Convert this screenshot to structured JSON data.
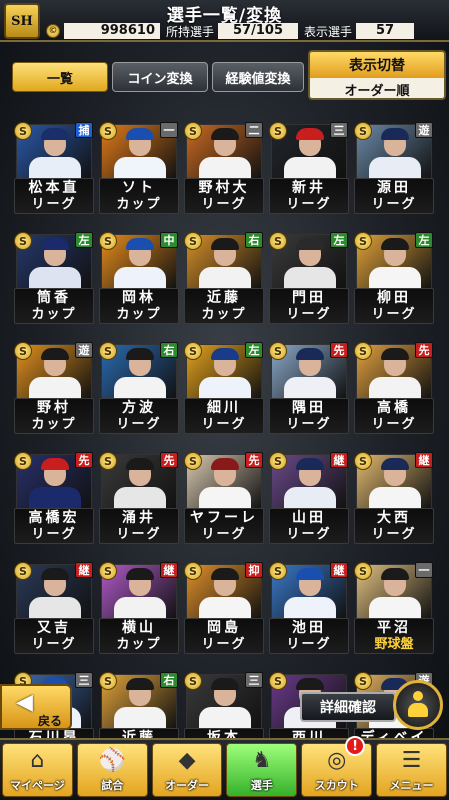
{
  "header": {
    "logo": "SH",
    "title": "選手一覧/変換",
    "coins": "998610",
    "owned_label": "所持選手",
    "owned_value": "57/105",
    "displayed_label": "表示選手",
    "displayed_value": "57"
  },
  "tabs": [
    "一覧",
    "コイン変換",
    "経験値変換"
  ],
  "display_switch": {
    "label": "表示切替",
    "value": "オーダー順"
  },
  "colors": {
    "gold": "#ffd23a",
    "green": "#36b12a",
    "alert": "#e21a1a"
  },
  "players": [
    {
      "name": "松本直",
      "type": "リーグ",
      "pos": "捕",
      "pos_color": "#1e5fd6",
      "bg": "#2a58a8",
      "cap": "#1a2f6a",
      "body": "#e8eef8"
    },
    {
      "name": "ソト",
      "type": "カップ",
      "pos": "一",
      "pos_color": "#6a6a6a",
      "bg": "#e07a1a",
      "cap": "#1a4fb0",
      "body": "#f0f4fb"
    },
    {
      "name": "野村大",
      "type": "リーグ",
      "pos": "二",
      "pos_color": "#6a6a6a",
      "bg": "#c96a22",
      "cap": "#1a1a1a",
      "body": "#f3f3f3"
    },
    {
      "name": "新井",
      "type": "リーグ",
      "pos": "三",
      "pos_color": "#6a6a6a",
      "bg": "#20242a",
      "cap": "#c81e1e",
      "body": "#f2f2f2"
    },
    {
      "name": "源田",
      "type": "リーグ",
      "pos": "遊",
      "pos_color": "#6a6a6a",
      "bg": "#6a8aa8",
      "cap": "#1a2a58",
      "body": "#e8ecf4"
    },
    {
      "name": "筒香",
      "type": "カップ",
      "pos": "左",
      "pos_color": "#2e8a2e",
      "bg": "#24386a",
      "cap": "#1a2a6a",
      "body": "#dde3f0"
    },
    {
      "name": "岡林",
      "type": "カップ",
      "pos": "中",
      "pos_color": "#2e8a2e",
      "bg": "#e38a1c",
      "cap": "#1a4fb0",
      "body": "#eef2fa"
    },
    {
      "name": "近藤",
      "type": "カップ",
      "pos": "右",
      "pos_color": "#2e8a2e",
      "bg": "#d6902a",
      "cap": "#1a1a1a",
      "body": "#f2f2f2"
    },
    {
      "name": "門田",
      "type": "リーグ",
      "pos": "左",
      "pos_color": "#2e8a2e",
      "bg": "#3a3a3a",
      "cap": "#2a2a2a",
      "body": "#e6e6e6"
    },
    {
      "name": "柳田",
      "type": "リーグ",
      "pos": "左",
      "pos_color": "#2e8a2e",
      "bg": "#e0a23a",
      "cap": "#1a1a1a",
      "body": "#f5f5f5"
    },
    {
      "name": "野村",
      "type": "カップ",
      "pos": "遊",
      "pos_color": "#6a6a6a",
      "bg": "#e0901e",
      "cap": "#1a1a1a",
      "body": "#f3f3f3"
    },
    {
      "name": "方波",
      "type": "リーグ",
      "pos": "右",
      "pos_color": "#2e8a2e",
      "bg": "#2a6ab0",
      "cap": "#1a1a1a",
      "body": "#f3f3f3"
    },
    {
      "name": "細川",
      "type": "リーグ",
      "pos": "左",
      "pos_color": "#2e8a2e",
      "bg": "#e3a11c",
      "cap": "#1a3a8a",
      "body": "#eef2fa"
    },
    {
      "name": "隅田",
      "type": "リーグ",
      "pos": "先",
      "pos_color": "#c81e1e",
      "bg": "#8aa8c8",
      "cap": "#1a2a58",
      "body": "#eef0f5"
    },
    {
      "name": "高橋",
      "type": "リーグ",
      "pos": "先",
      "pos_color": "#c81e1e",
      "bg": "#e0a040",
      "cap": "#1a1a1a",
      "body": "#f3f3f3"
    },
    {
      "name": "高橋宏",
      "type": "リーグ",
      "pos": "先",
      "pos_color": "#c81e1e",
      "bg": "#28306a",
      "cap": "#c81e1e",
      "body": "#1a2a6a"
    },
    {
      "name": "涌井",
      "type": "リーグ",
      "pos": "先",
      "pos_color": "#c81e1e",
      "bg": "#3a3a3a",
      "cap": "#1a1a1a",
      "body": "#e6e6e6"
    },
    {
      "name": "ヤフーレ",
      "type": "リーグ",
      "pos": "先",
      "pos_color": "#c81e1e",
      "bg": "#d8c8b0",
      "cap": "#8a1a1a",
      "body": "#f5f5f5"
    },
    {
      "name": "山田",
      "type": "リーグ",
      "pos": "継",
      "pos_color": "#c81e1e",
      "bg": "#6a4a8a",
      "cap": "#1a2a58",
      "body": "#e8ecf4"
    },
    {
      "name": "大西",
      "type": "リーグ",
      "pos": "継",
      "pos_color": "#c81e1e",
      "bg": "#e0b870",
      "cap": "#1a2a58",
      "body": "#f5f5f5"
    },
    {
      "name": "又吉",
      "type": "リーグ",
      "pos": "継",
      "pos_color": "#c81e1e",
      "bg": "#2a3a58",
      "cap": "#1a1a1a",
      "body": "#e6e6e6"
    },
    {
      "name": "横山",
      "type": "カップ",
      "pos": "継",
      "pos_color": "#c81e1e",
      "bg": "#b05ac8",
      "cap": "#1a1a1a",
      "body": "#f2f2f2"
    },
    {
      "name": "岡島",
      "type": "リーグ",
      "pos": "抑",
      "pos_color": "#c81e1e",
      "bg": "#e0902a",
      "cap": "#1a1a1a",
      "body": "#f5f5f5"
    },
    {
      "name": "池田",
      "type": "リーグ",
      "pos": "継",
      "pos_color": "#c81e1e",
      "bg": "#3a78c8",
      "cap": "#1a4fb0",
      "body": "#eef2fa"
    },
    {
      "name": "平沼",
      "type": "野球盤",
      "pos": "一",
      "pos_color": "#6a6a6a",
      "bg": "#e0c080",
      "cap": "#1a1a1a",
      "body": "#f5f5f5"
    },
    {
      "name": "石川昂",
      "type": "",
      "pos": "三",
      "pos_color": "#6a6a6a",
      "bg": "#3a6ab0",
      "cap": "#1a4fb0",
      "body": "#eef2fa"
    },
    {
      "name": "近藤",
      "type": "",
      "pos": "右",
      "pos_color": "#2e8a2e",
      "bg": "#e0a23a",
      "cap": "#1a1a1a",
      "body": "#f3f3f3"
    },
    {
      "name": "坂本",
      "type": "",
      "pos": "三",
      "pos_color": "#6a6a6a",
      "bg": "#3a3a3a",
      "cap": "#1a1a1a",
      "body": "#f3f3f3"
    },
    {
      "name": "西川",
      "type": "",
      "pos": "",
      "pos_color": "#6a6a6a",
      "bg": "#6a3a8a",
      "cap": "#1a1a1a",
      "body": "#eef0f5"
    },
    {
      "name": "ディベイニー",
      "type": "",
      "pos": "遊",
      "pos_color": "#6a6a6a",
      "bg": "#e0b060",
      "cap": "#1a2a58",
      "body": "#f5f5f5"
    }
  ],
  "actions": {
    "back_label": "戻る",
    "detail_label": "詳細確認"
  },
  "nav": [
    {
      "label": "マイページ",
      "icon": "home-icon",
      "glyph": "⌂",
      "active": false
    },
    {
      "label": "試合",
      "icon": "bat-icon",
      "glyph": "⚾",
      "active": false
    },
    {
      "label": "オーダー",
      "icon": "field-icon",
      "glyph": "◆",
      "active": false
    },
    {
      "label": "選手",
      "icon": "player-icon",
      "glyph": "♞",
      "active": true
    },
    {
      "label": "スカウト",
      "icon": "scout-icon",
      "glyph": "◎",
      "active": false,
      "badge": "!"
    },
    {
      "label": "メニュー",
      "icon": "menu-icon",
      "glyph": "☰",
      "active": false
    }
  ]
}
